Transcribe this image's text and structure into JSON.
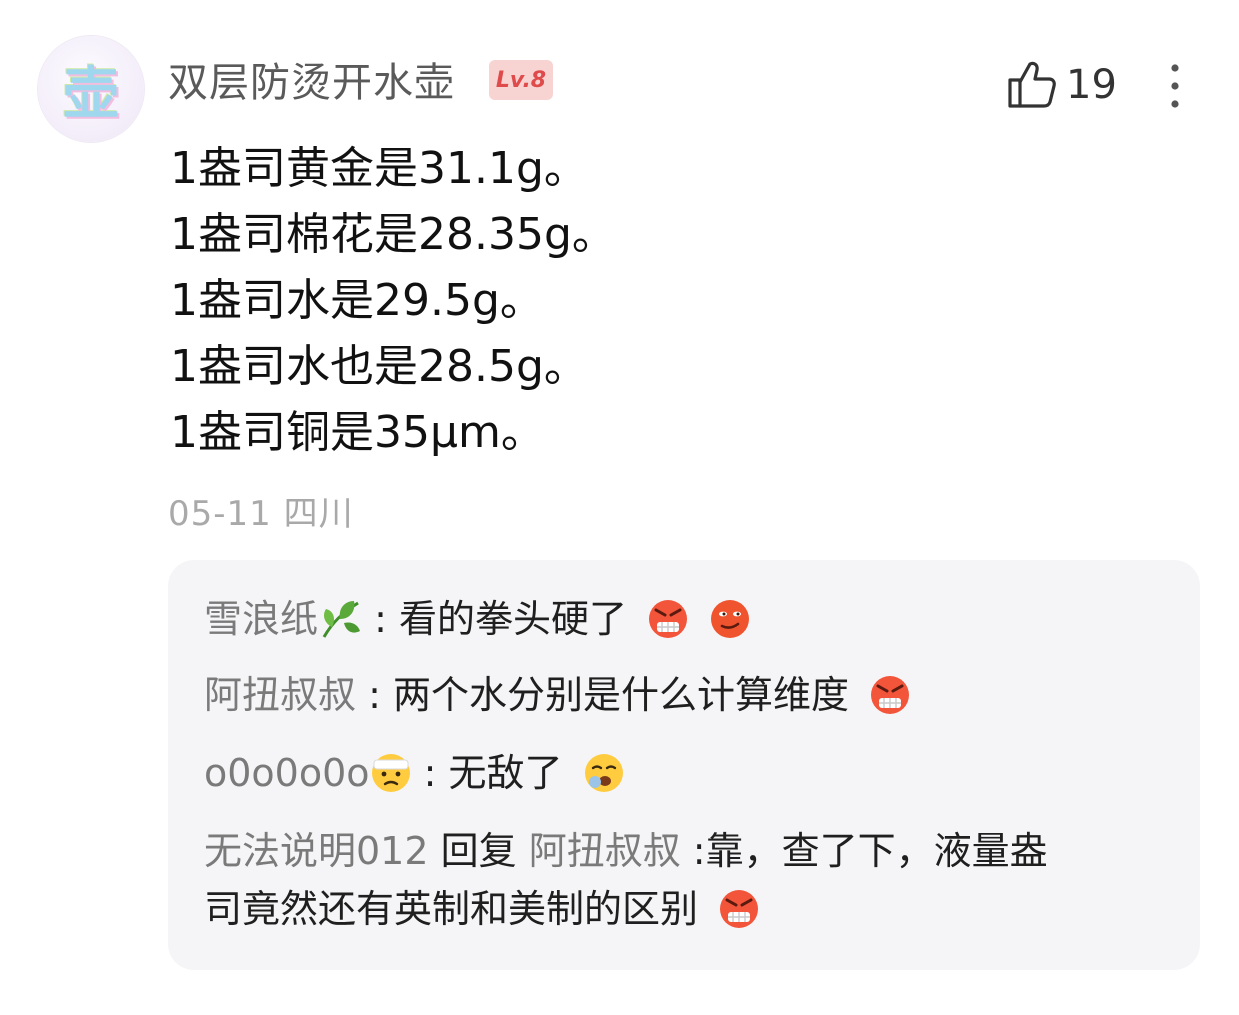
{
  "comment": {
    "avatar_char": "壶",
    "username": "双层防烫开水壶",
    "level": "Lv.8",
    "likes": "19",
    "lines": [
      "1盎司黄金是31.1g。",
      "1盎司棉花是28.35g。",
      "1盎司水是29.5g。",
      "1盎司水也是28.5g。",
      "1盎司铜是35μm。"
    ],
    "date": "05-11",
    "location": "四川"
  },
  "replies": [
    {
      "name": "雪浪纸",
      "sep": " : ",
      "text": "看的拳头硬了",
      "emojis": [
        "angry-emoji",
        "smirk-emoji"
      ]
    },
    {
      "name": "阿扭叔叔",
      "sep": " : ",
      "text": "两个水分别是什么计算维度",
      "emojis": [
        "angry-emoji"
      ]
    },
    {
      "name": "o0o0o0o",
      "sep": " : ",
      "text": "无敌了",
      "emojis": [
        "injured-emoji",
        "yawn-emoji"
      ]
    },
    {
      "name": "无法说明012",
      "reply_word": " 回复 ",
      "reply_to": "阿扭叔叔",
      "sep": " :",
      "text_line1": "靠，查了下，液量盎",
      "text_line2": "司竟然还有英制和美制的区别",
      "emojis": [
        "angry-emoji"
      ]
    }
  ],
  "colors": {
    "accent_red": "#df4b4b",
    "badge_bg": "#f7d4d2",
    "reply_bg": "#f5f5f7",
    "muted_text": "#a9a9a9"
  }
}
